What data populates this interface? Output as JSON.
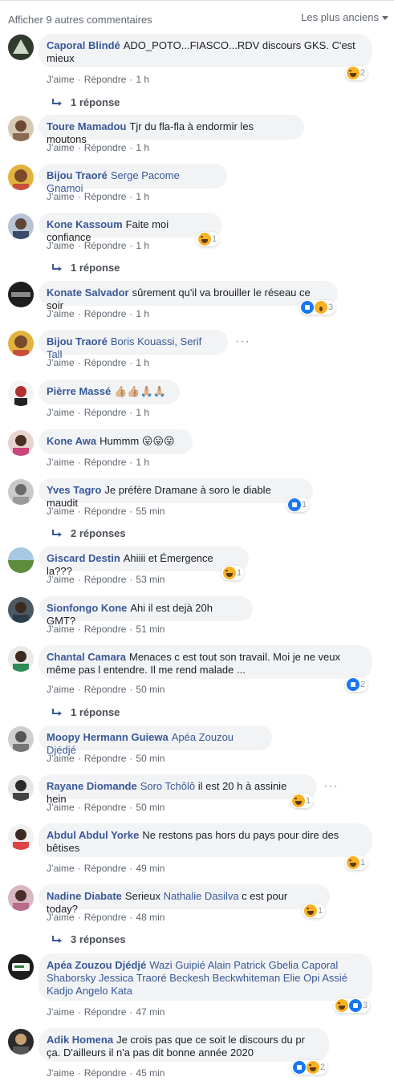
{
  "header": {
    "more_comments": "Afficher 9 autres commentaires",
    "sort_label": "Les plus anciens"
  },
  "labels": {
    "like": "J’aime",
    "reply": "Répondre"
  },
  "colors": {
    "name": "#385898",
    "bubble": "#f2f3f5",
    "like_icon": "#1877f2",
    "haha_icon": "#f7b125"
  },
  "comments": [
    {
      "name": "Caporal Blindé",
      "text": "ADO_POTO...FIASCO...RDV discours GKS. C'est mieux",
      "time": "1 h",
      "reactions": [
        "haha-icon"
      ],
      "count": "2",
      "replies": "1 réponse"
    },
    {
      "name": "Toure Mamadou",
      "text": "Tjr du fla-fla à endormir les moutons",
      "time": "1 h"
    },
    {
      "name": "Bijou Traoré",
      "tag": "Serge Pacome Gnamoi",
      "time": "1 h"
    },
    {
      "name": "Kone Kassoum",
      "text": "Faite moi confiance",
      "time": "1 h",
      "reactions": [
        "haha-icon"
      ],
      "count": "1",
      "replies": "1 réponse"
    },
    {
      "name": "Konate Salvador",
      "text": "sûrement qu'il va brouiller le réseau ce soir",
      "time": "1 h",
      "reactions": [
        "like-icon",
        "wow-icon"
      ],
      "count": "3"
    },
    {
      "name": "Bijou Traoré",
      "tag": "Boris Kouassi, Serif Tall",
      "time": "1 h"
    },
    {
      "name": "Pièrre Massé",
      "text": "👍🏼👍🏼🙏🏼🙏🏼",
      "time": "1 h"
    },
    {
      "name": "Kone Awa",
      "text": "Hummm 😛😛😛",
      "time": "1 h"
    },
    {
      "name": "Yves Tagro",
      "text": "Je préfère Dramane à soro le diable maudit",
      "time": "55 min",
      "reactions": [
        "like-icon"
      ],
      "count": "1",
      "replies": "2 réponses"
    },
    {
      "name": "Giscard Destin",
      "text": "Ahiiii et Émergence la???",
      "time": "53 min",
      "reactions": [
        "haha-icon"
      ],
      "count": "1"
    },
    {
      "name": "Sionfongo Kone",
      "text": "Ahi il est dejà 20h GMT?",
      "time": "51 min"
    },
    {
      "name": "Chantal Camara",
      "text": "Menaces c est tout son travail. Moi je ne veux même pas l entendre. Il me rend malade ...",
      "time": "50 min",
      "reactions": [
        "like-icon"
      ],
      "count": "2",
      "replies": "1 réponse"
    },
    {
      "name": "Moopy Hermann Guiewa",
      "tag": "Apéa Zouzou Djédjé",
      "time": "50 min"
    },
    {
      "name": "Rayane Diomande",
      "tag": "Soro Tchôlô",
      "text": " il est 20 h à assinie hein",
      "time": "50 min",
      "reactions": [
        "haha-icon"
      ],
      "count": "1"
    },
    {
      "name": "Abdul Abdul Yorke",
      "text": "Ne restons pas hors du pays pour dire des bêtises",
      "time": "49 min",
      "reactions": [
        "haha-icon"
      ],
      "count": "1"
    },
    {
      "name": "Nadine Diabate",
      "text": "Serieux ",
      "tag": "Nathalie Dasilva",
      "text2": " c est pour today?",
      "time": "48 min",
      "reactions": [
        "haha-icon"
      ],
      "count": "1",
      "replies": "3 réponses"
    },
    {
      "name": "Apéa Zouzou Djédjé",
      "tag": "Wazi Guipié Alain Patrick Gbelia Caporal Shaborsky Jessica Traoré Beckesh Beckwhiteman Elie Opi Assié Kadjo Angelo Kata",
      "time": "47 min",
      "reactions": [
        "haha-icon",
        "like-icon"
      ],
      "count": "3"
    },
    {
      "name": "Adik Homena",
      "text": "Je crois pas que ce soit le discours du pr ça. D'ailleurs il n'a pas dit bonne année 2020",
      "time": "45 min",
      "reactions": [
        "like-icon",
        "haha-icon"
      ],
      "count": "2"
    }
  ]
}
